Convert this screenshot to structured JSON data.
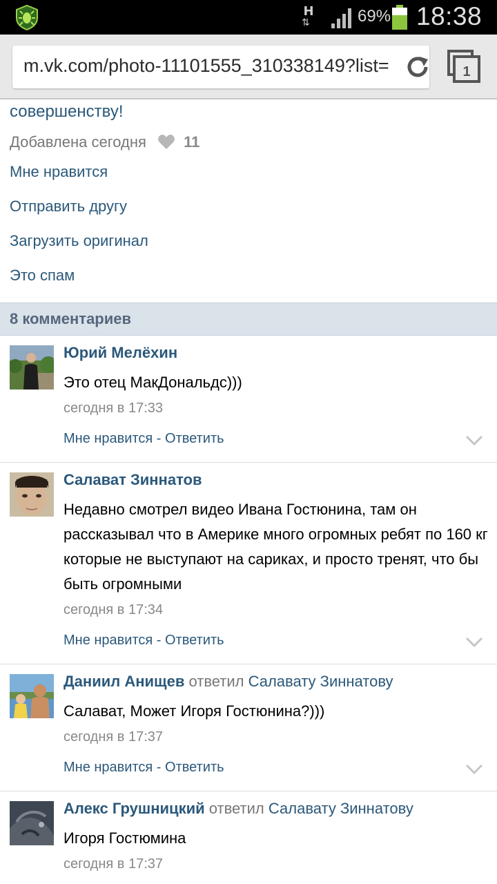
{
  "status_bar": {
    "network_type": "H",
    "network_arrows": "⇅",
    "battery_percent": "69%",
    "time": "18:38",
    "battery_color": "#8cc63f",
    "app_icon": "shield-bug-icon",
    "signal_icon": "signal-bars-icon"
  },
  "browser": {
    "url": "m.vk.com/photo-11101555_310338149?list=",
    "reload_icon": "reload-icon",
    "tabs_icon": "tabs-icon",
    "tabs_count": "1"
  },
  "photo": {
    "description_tail": "совершенству!",
    "added_label": "Добавлена сегодня",
    "likes_count": "11",
    "actions": [
      "Мне нравится",
      "Отправить другу",
      "Загрузить оригинал",
      "Это спам"
    ]
  },
  "comments": {
    "header": "8 комментариев",
    "items": [
      {
        "author": "Юрий Мелёхин",
        "text": "Это отец МакДональдс)))",
        "time": "сегодня в 17:33",
        "like_label": "Мне нравится",
        "separator": " - ",
        "reply_label": "Ответить"
      },
      {
        "author": "Салават Зиннатов",
        "text": "Недавно смотрел видео Ивана Гостюнина, там он рассказывал что в Америке много огромных ребят по 160 кг которые не выступают на сариках, и просто тренят, что бы быть огромными",
        "time": "сегодня в 17:34",
        "like_label": "Мне нравится",
        "separator": " - ",
        "reply_label": "Ответить"
      },
      {
        "author": "Даниил Анищев",
        "replied": "ответил",
        "reply_to": "Салавату Зиннатову",
        "text": "Салават, Может Игоря Гостюнина?)))",
        "time": "сегодня в 17:37",
        "like_label": "Мне нравится",
        "separator": " - ",
        "reply_label": "Ответить"
      },
      {
        "author": "Алекс Грушницкий",
        "replied": "ответил",
        "reply_to": "Салавату Зиннатову",
        "text": "Игоря Гостюмина",
        "time": "сегодня в 17:37"
      }
    ]
  },
  "colors": {
    "link": "#2b587a",
    "header_bg": "#dae2ea",
    "status_bar_bg": "#000000"
  }
}
